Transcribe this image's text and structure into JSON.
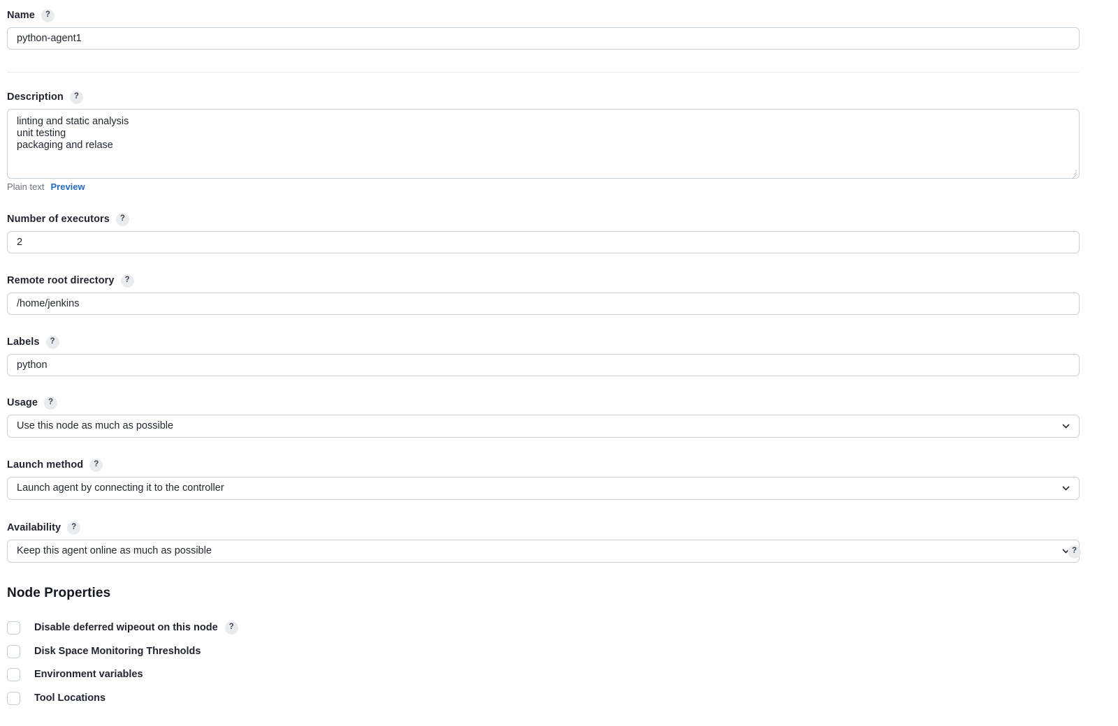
{
  "fields": {
    "name": {
      "label": "Name",
      "help": "?",
      "value": "python-agent1"
    },
    "description": {
      "label": "Description",
      "help": "?",
      "value": "linting and static analysis\nunit testing\npackaging and relase",
      "markup_type": "Plain text",
      "preview_label": "Preview"
    },
    "executors": {
      "label": "Number of executors",
      "help": "?",
      "value": "2"
    },
    "remote_root": {
      "label": "Remote root directory",
      "help": "?",
      "value": "/home/jenkins"
    },
    "labels": {
      "label": "Labels",
      "help": "?",
      "value": "python"
    },
    "usage": {
      "label": "Usage",
      "help": "?",
      "value": "Use this node as much as possible"
    },
    "launch_method": {
      "label": "Launch method",
      "help": "?",
      "value": "Launch agent by connecting it to the controller"
    },
    "availability": {
      "label": "Availability",
      "help": "?",
      "value": "Keep this agent online as much as possible",
      "side_help": "?"
    }
  },
  "node_properties": {
    "heading": "Node Properties",
    "items": [
      {
        "label": "Disable deferred wipeout on this node",
        "checked": false,
        "help": "?"
      },
      {
        "label": "Disk Space Monitoring Thresholds",
        "checked": false,
        "help": null
      },
      {
        "label": "Environment variables",
        "checked": false,
        "help": null
      },
      {
        "label": "Tool Locations",
        "checked": false,
        "help": null
      }
    ]
  },
  "colors": {
    "link": "#2569c2",
    "border": "#c9d1d9",
    "help_badge_bg": "#e9ecef",
    "text": "#1f2430",
    "muted": "#6b7280"
  }
}
